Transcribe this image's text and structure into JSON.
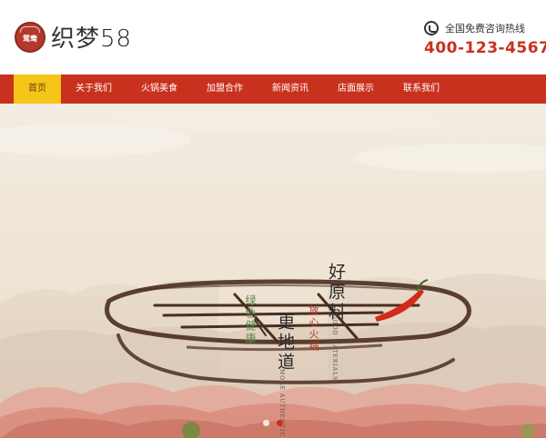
{
  "logo": {
    "seal_text": "鸳鸯",
    "brand_text": "织梦",
    "brand_number": "58"
  },
  "hotline": {
    "label": "全国免费咨询热线",
    "number": "400-123-4567",
    "icon": "phone-icon"
  },
  "nav": {
    "items": [
      {
        "label": "首页",
        "active": true
      },
      {
        "label": "关于我们"
      },
      {
        "label": "火锅美食"
      },
      {
        "label": "加盟合作"
      },
      {
        "label": "新闻资讯"
      },
      {
        "label": "店面展示"
      },
      {
        "label": "联系我们"
      }
    ]
  },
  "banner": {
    "text_original": "好原料",
    "text_road": "更地道",
    "text_green": "绿色健康",
    "text_hotpot": "放心火锅",
    "en_original": "GOOD MATERIALS",
    "en_road": "MORE AUTHENTIC",
    "slides": 2,
    "active_slide": 1
  },
  "colors": {
    "brand_red": "#c8311e",
    "nav_active": "#f5c518",
    "chili": "#d42a1a",
    "ink": "#4a2e1f"
  }
}
